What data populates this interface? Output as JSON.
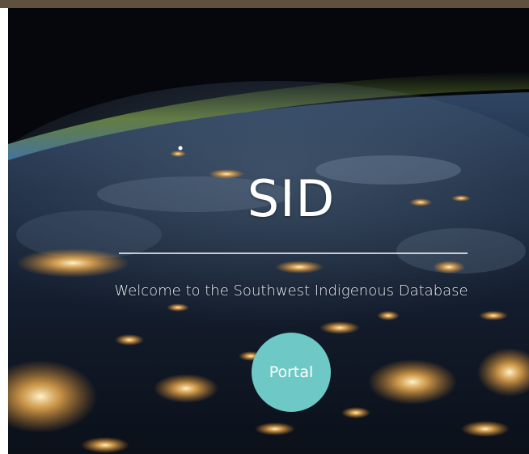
{
  "header": {
    "bar_color": "#5e523e"
  },
  "hero": {
    "background": "earth-at-night-from-space-image",
    "title": "SID",
    "subtitle": "Welcome to the Southwest Indigenous Database",
    "portal_button": {
      "label": "Portal",
      "color": "#6dc8c6"
    }
  }
}
